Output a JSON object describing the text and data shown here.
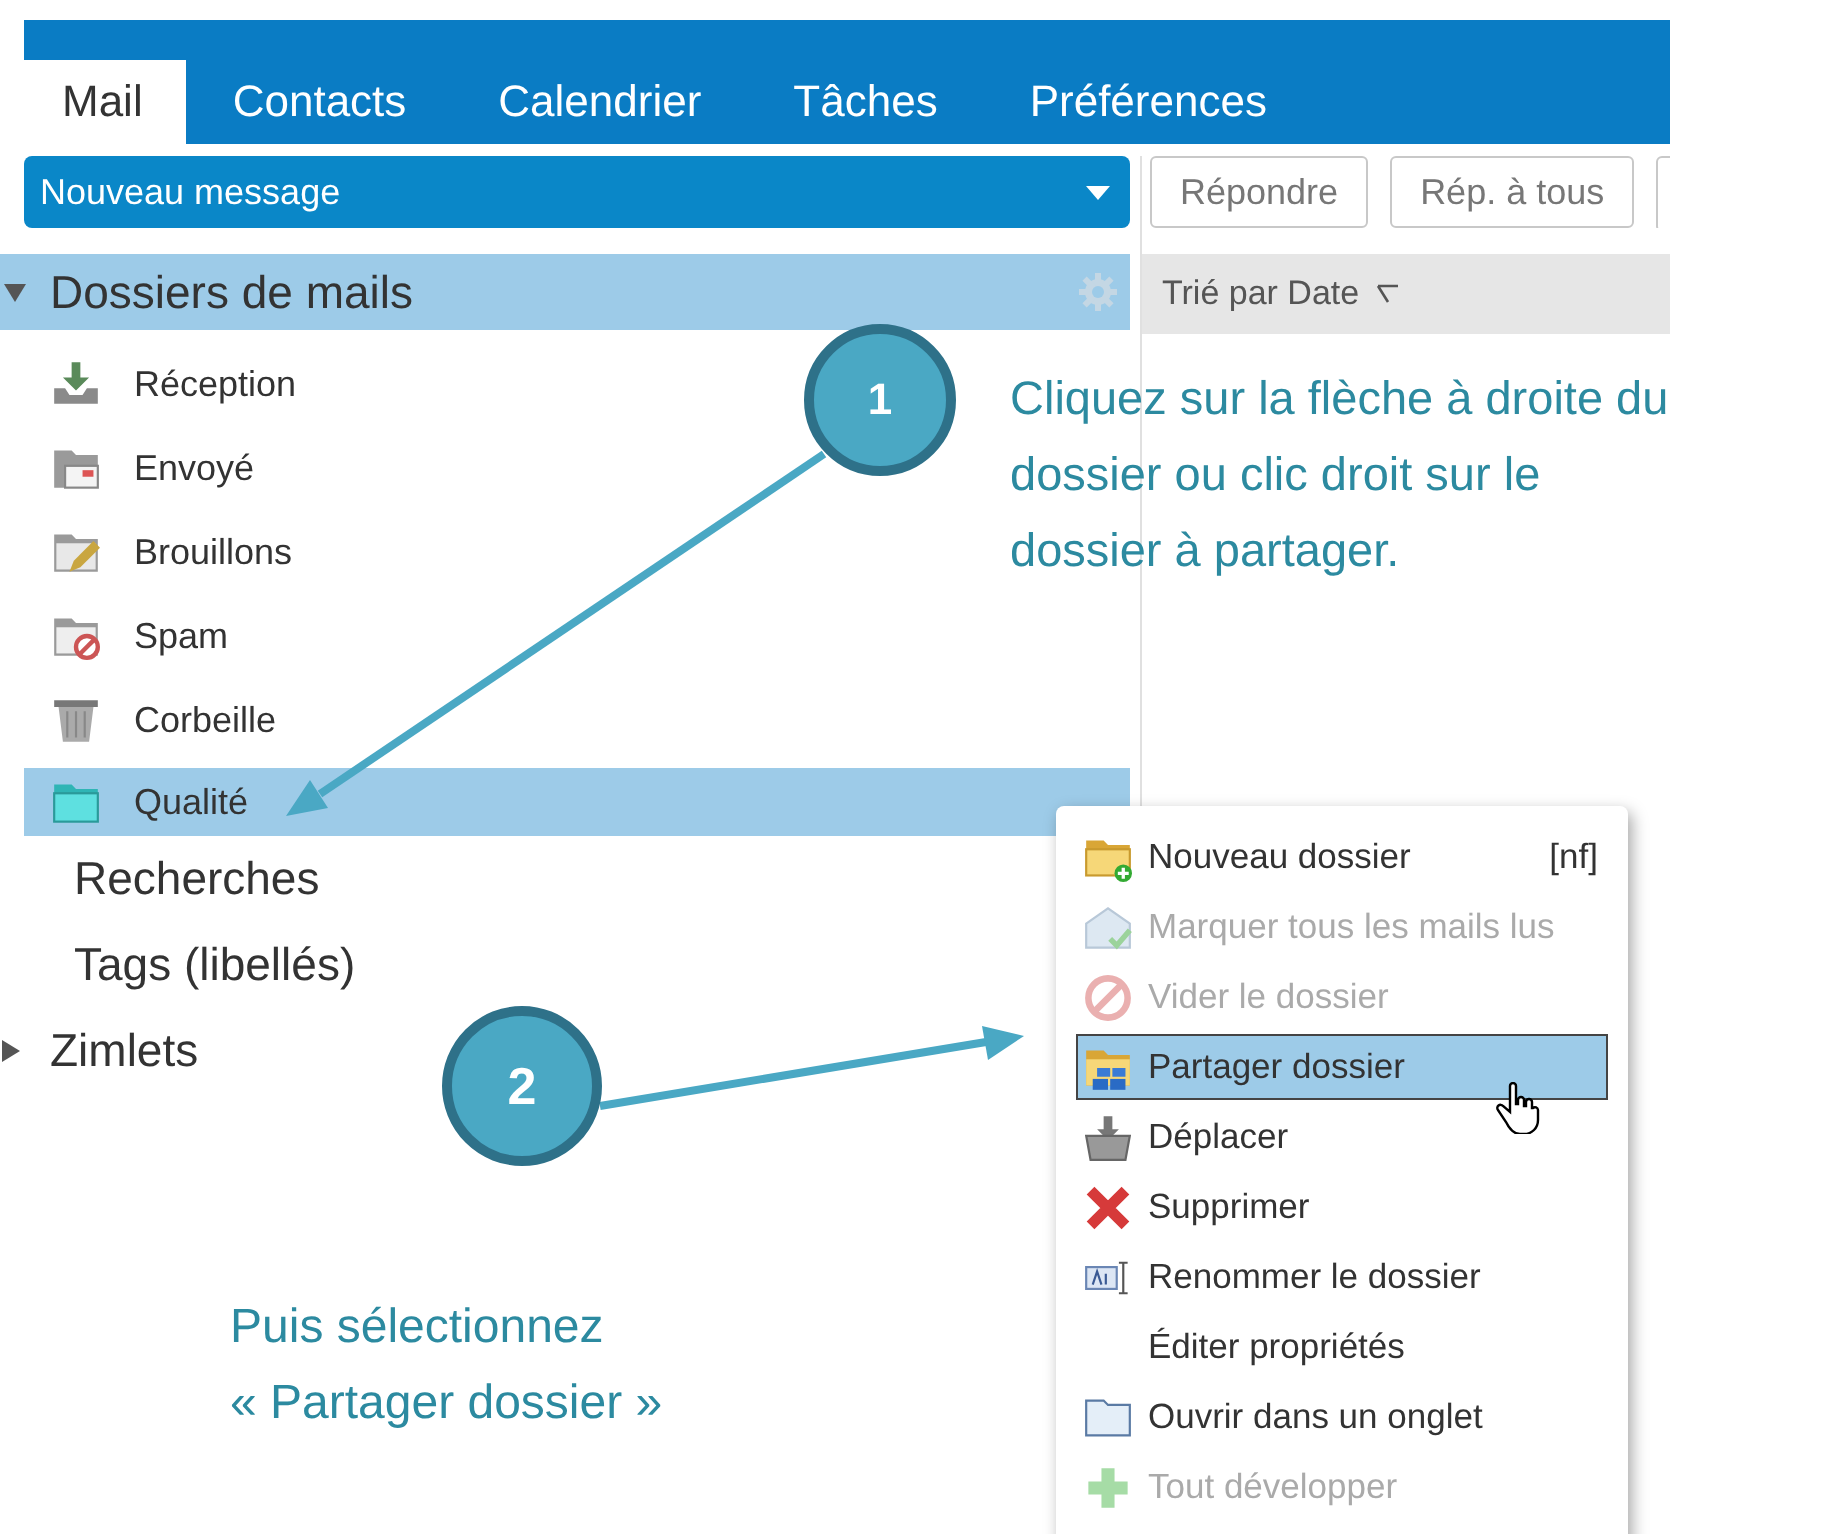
{
  "tabs": [
    {
      "label": "Mail",
      "selected": true
    },
    {
      "label": "Contacts",
      "selected": false
    },
    {
      "label": "Calendrier",
      "selected": false
    },
    {
      "label": "Tâches",
      "selected": false
    },
    {
      "label": "Préférences",
      "selected": false
    }
  ],
  "new_message": {
    "label": "Nouveau message"
  },
  "folder_panel": {
    "header": "Dossiers de mails",
    "expanded": true,
    "folders": [
      {
        "label": "Réception",
        "kind": "inbox",
        "selected": false
      },
      {
        "label": "Envoyé",
        "kind": "sent",
        "selected": false
      },
      {
        "label": "Brouillons",
        "kind": "drafts",
        "selected": false
      },
      {
        "label": "Spam",
        "kind": "spam",
        "selected": false
      },
      {
        "label": "Corbeille",
        "kind": "trash",
        "selected": false
      },
      {
        "label": "Qualité",
        "kind": "folder",
        "selected": true
      }
    ]
  },
  "sections": [
    {
      "label": "Recherches",
      "expandable": false
    },
    {
      "label": "Tags (libellés)",
      "expandable": false
    },
    {
      "label": "Zimlets",
      "expandable": true
    }
  ],
  "toolbar_buttons": [
    "Répondre",
    "Rép. à tous"
  ],
  "sort_label": "Trié par Date",
  "context_menu": {
    "items": [
      {
        "label": "Nouveau dossier",
        "kind": "new-folder",
        "shortcut": "[nf]",
        "disabled": false,
        "selected": false
      },
      {
        "label": "Marquer tous les mails lus",
        "kind": "mark-read",
        "disabled": true,
        "selected": false
      },
      {
        "label": "Vider le dossier",
        "kind": "empty",
        "disabled": true,
        "selected": false
      },
      {
        "label": "Partager dossier",
        "kind": "share",
        "disabled": false,
        "selected": true
      },
      {
        "label": "Déplacer",
        "kind": "move",
        "disabled": false,
        "selected": false
      },
      {
        "label": "Supprimer",
        "kind": "delete",
        "disabled": false,
        "selected": false
      },
      {
        "label": "Renommer le dossier",
        "kind": "rename",
        "disabled": false,
        "selected": false
      },
      {
        "label": "Éditer propriétés",
        "kind": "plain",
        "disabled": false,
        "selected": false
      },
      {
        "label": "Ouvrir dans un onglet",
        "kind": "open-tab",
        "disabled": false,
        "selected": false
      },
      {
        "label": "Tout développer",
        "kind": "expand",
        "disabled": true,
        "selected": false
      }
    ]
  },
  "callouts": [
    {
      "number": "1",
      "lines": [
        "Cliquez sur la flèche à droite du",
        "dossier ou clic droit sur le",
        "dossier à partager."
      ]
    },
    {
      "number": "2",
      "lines": [
        "Puis sélectionnez",
        "« Partager dossier »"
      ]
    }
  ]
}
